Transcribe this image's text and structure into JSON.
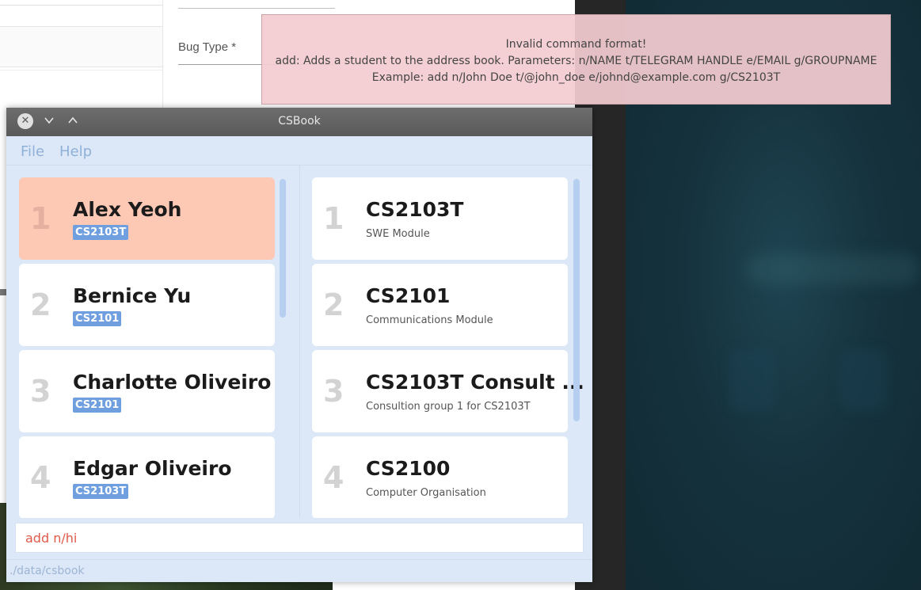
{
  "background": {
    "bug_type_label": "Bug Type *"
  },
  "result_display": {
    "lines": [
      "Invalid command format!",
      "add: Adds a student to the address book. Parameters: n/NAME t/TELEGRAM HANDLE e/EMAIL g/GROUPNAME",
      "Example: add n/John Doe t/@john_doe e/johnd@example.com g/CS2103T"
    ]
  },
  "window": {
    "title": "CSBook",
    "close_icon": "close-icon",
    "minimize_icon": "chevron-down-icon",
    "maximize_icon": "chevron-up-icon"
  },
  "menu": {
    "file": "File",
    "help": "Help"
  },
  "students": [
    {
      "index": "1",
      "name": "Alex Yeoh",
      "group": "CS2103T"
    },
    {
      "index": "2",
      "name": "Bernice Yu",
      "group": "CS2101"
    },
    {
      "index": "3",
      "name": "Charlotte Oliveiro",
      "group": "CS2101"
    },
    {
      "index": "4",
      "name": "Edgar Oliveiro",
      "group": "CS2103T"
    }
  ],
  "groups": [
    {
      "index": "1",
      "name": "CS2103T",
      "description": "SWE Module"
    },
    {
      "index": "2",
      "name": "CS2101",
      "description": "Communications Module"
    },
    {
      "index": "3",
      "name": "CS2103T Consult ...",
      "description": "Consultion group 1 for CS2103T"
    },
    {
      "index": "4",
      "name": "CS2100",
      "description": "Computer Organisation"
    }
  ],
  "command_box": {
    "value": "add n/hi"
  },
  "status_bar": {
    "path": "./data/csbook"
  },
  "colors": {
    "selected_card": "#fdc8b4",
    "tag": "#6f9fde",
    "error_popup": "#f3ccd1",
    "app_background": "#dce8f7"
  }
}
